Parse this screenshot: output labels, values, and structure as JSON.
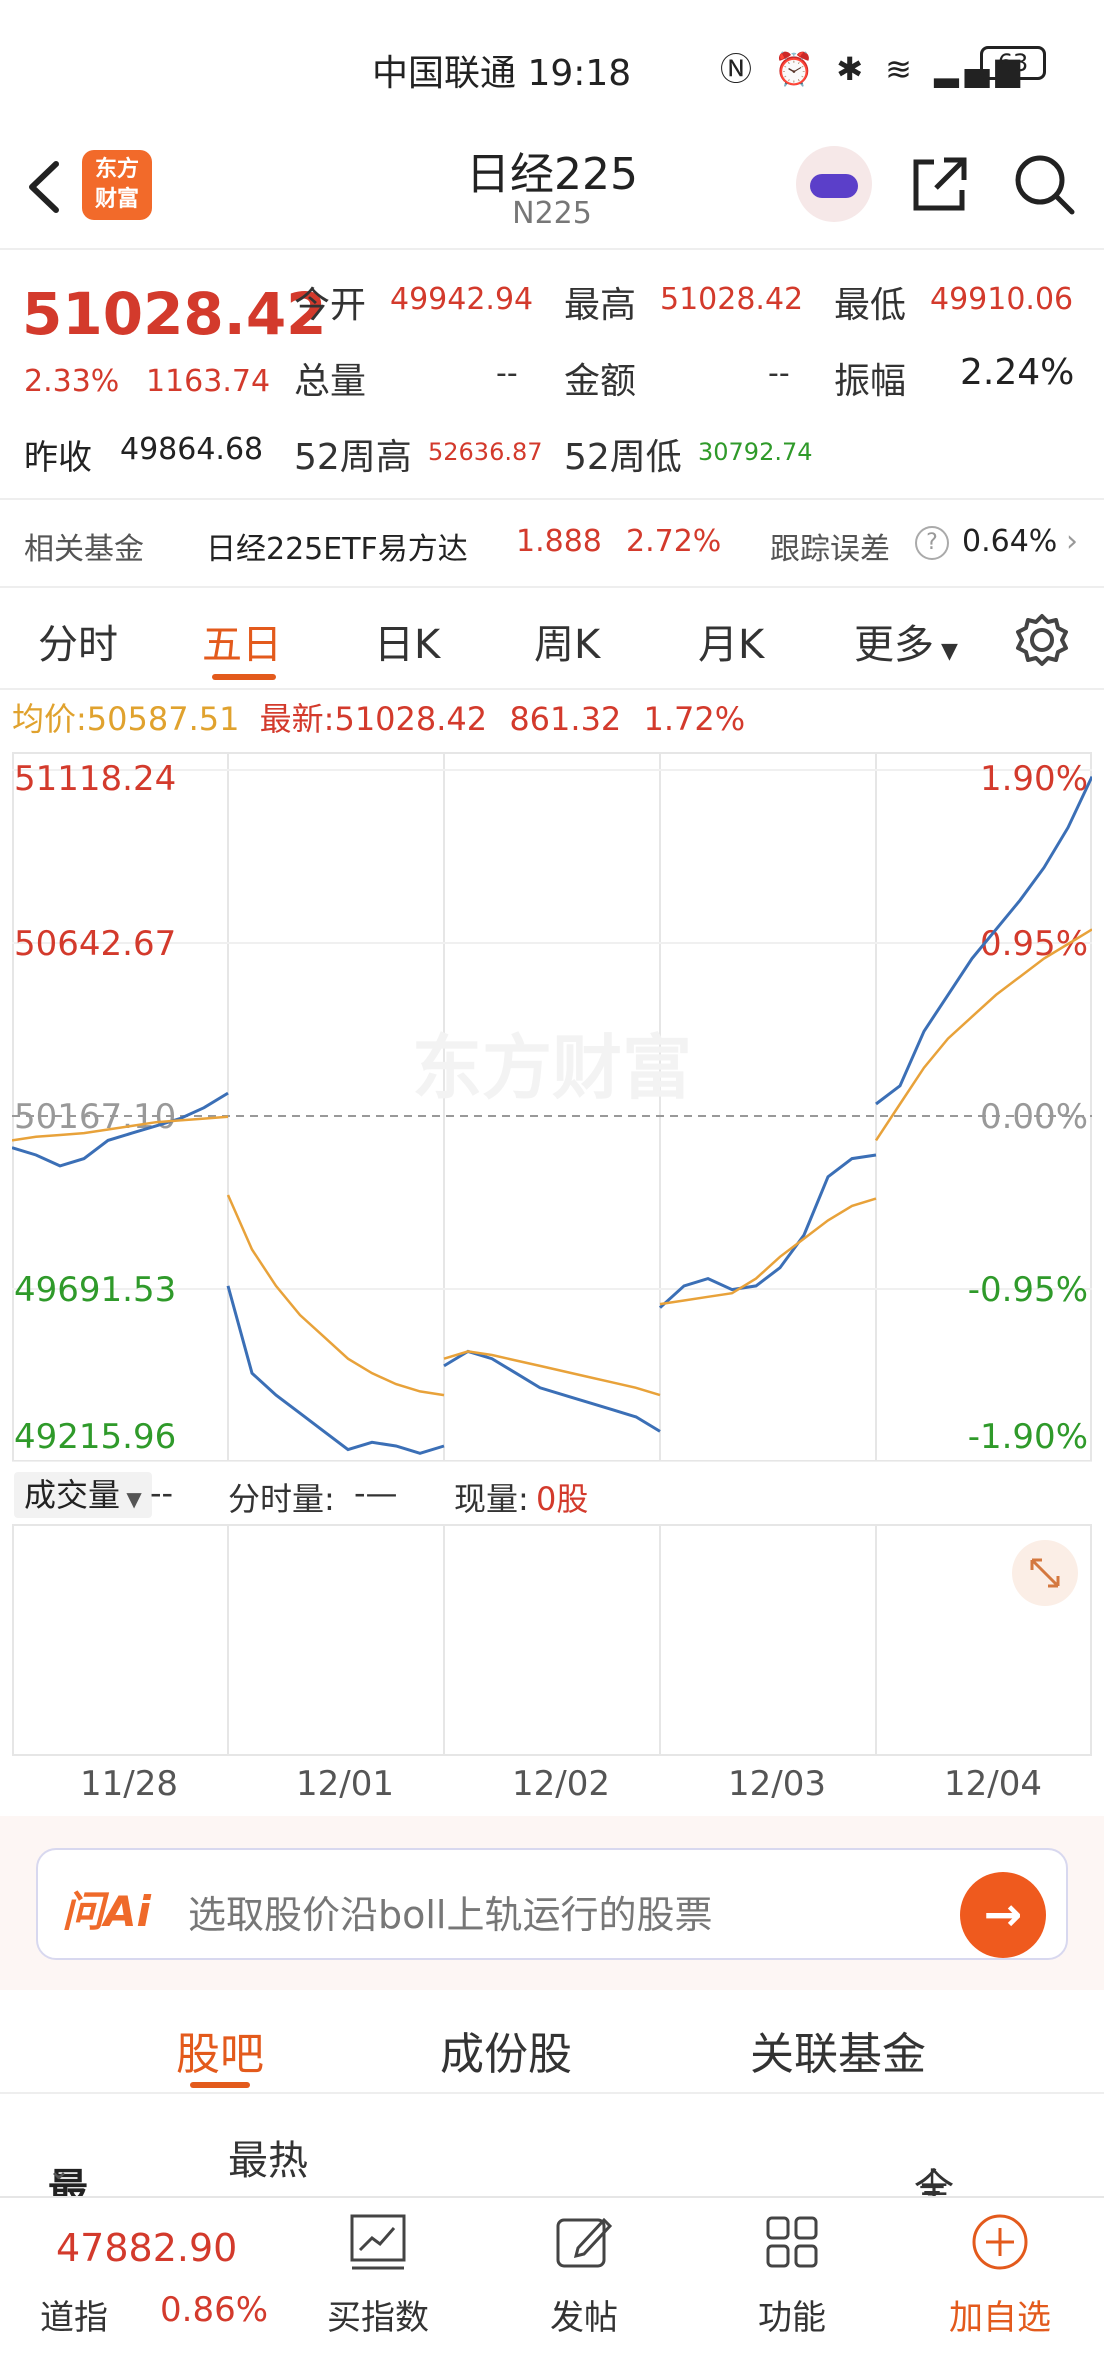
{
  "status_bar": {
    "carrier_time": "中国联通 19:18",
    "battery": "63"
  },
  "header": {
    "logo_line1": "东方",
    "logo_line2": "财富",
    "title": "日经225",
    "subtitle": "N225"
  },
  "quote": {
    "price": "51028.42",
    "pct": "2.33%",
    "change": "1163.74",
    "prev_close_label": "昨收",
    "prev_close": "49864.68",
    "open_label": "今开",
    "open": "49942.94",
    "high_label": "最高",
    "high": "51028.42",
    "low_label": "最低",
    "low": "49910.06",
    "volume_label": "总量",
    "volume": "--",
    "amount_label": "金额",
    "amount": "--",
    "amplitude_label": "振幅",
    "amplitude": "2.24%",
    "w52_high_label": "52周高",
    "w52_high": "52636.87",
    "w52_low_label": "52周低",
    "w52_low": "30792.74"
  },
  "fund_row": {
    "label": "相关基金",
    "fund_name": "日经225ETF易方达",
    "fund_price": "1.888",
    "fund_pct": "2.72%",
    "tracking_label": "跟踪误差",
    "tracking_value": "0.64%"
  },
  "tabs": [
    "分时",
    "五日",
    "日K",
    "周K",
    "月K",
    "更多"
  ],
  "avg_line": {
    "avg_label": "均价:",
    "avg_value": "50587.51",
    "latest_label": "最新:",
    "latest_value": "51028.42",
    "latest_change": "861.32",
    "latest_pct": "1.72%"
  },
  "chart_data": {
    "type": "line",
    "title": "",
    "y_left_ticks": [
      "51118.24",
      "50642.67",
      "50167.10",
      "49691.53",
      "49215.96"
    ],
    "y_right_ticks": [
      "1.90%",
      "0.95%",
      "0.00%",
      "-0.95%",
      "-1.90%"
    ],
    "ylim": [
      49215.96,
      51118.24
    ],
    "reference": 50167.1,
    "x_days": [
      "11/28",
      "12/01",
      "12/02",
      "12/03",
      "12/04"
    ],
    "watermark": "东方财富",
    "series": [
      {
        "color": "#3b6fb6",
        "values": [
          50080,
          50060,
          50030,
          50050,
          50100,
          50120,
          50140,
          50160,
          50190,
          50230,
          49700,
          49460,
          49400,
          49350,
          49300,
          49250,
          49270,
          49260,
          49240,
          49260,
          49480,
          49520,
          49500,
          49460,
          49420,
          49400,
          49380,
          49360,
          49340,
          49300,
          49640,
          49700,
          49720,
          49690,
          49700,
          49750,
          49840,
          50000,
          50050,
          50060,
          50200,
          50250,
          50400,
          50500,
          50600,
          50680,
          50760,
          50850,
          50960,
          51100
        ]
      },
      {
        "color": "#e8a23a",
        "values": [
          50100,
          50110,
          50115,
          50120,
          50130,
          50140,
          50150,
          50155,
          50160,
          50165,
          49950,
          49800,
          49700,
          49620,
          49560,
          49500,
          49460,
          49430,
          49410,
          49400,
          49500,
          49520,
          49510,
          49495,
          49480,
          49465,
          49450,
          49435,
          49420,
          49400,
          49650,
          49660,
          49670,
          49680,
          49720,
          49780,
          49830,
          49880,
          49920,
          49940,
          50100,
          50200,
          50300,
          50380,
          50440,
          50500,
          50550,
          50600,
          50640,
          50680
        ]
      }
    ]
  },
  "volume": {
    "select_label": "成交量",
    "select_value": "--",
    "period_label": "分时量:",
    "period_value": "-—",
    "now_label": "现量:",
    "now_value": "0股"
  },
  "ai": {
    "logo": "问Ai",
    "prompt": "选取股价沿boll上轨运行的股票"
  },
  "subtabs": [
    "股吧",
    "成份股",
    "关联基金"
  ],
  "sort": {
    "latest": "最新",
    "hot": "最热",
    "filter": "全部"
  },
  "bottom_nav": {
    "index_value": "47882.90",
    "index_name": "道指",
    "index_pct": "0.86%",
    "buy_index": "买指数",
    "post": "发帖",
    "features": "功能",
    "add_watch": "加自选"
  }
}
